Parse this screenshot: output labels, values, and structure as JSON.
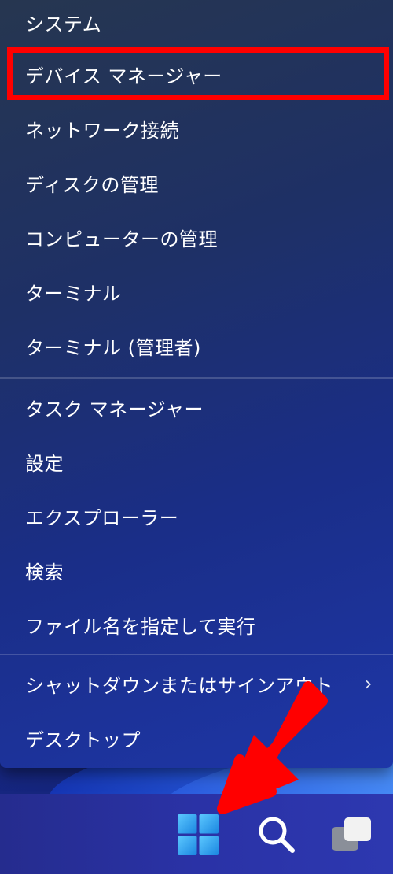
{
  "context_menu": {
    "items": [
      {
        "label": "システム"
      },
      {
        "label": "デバイス マネージャー"
      },
      {
        "label": "ネットワーク接続"
      },
      {
        "label": "ディスクの管理"
      },
      {
        "label": "コンピューターの管理"
      },
      {
        "label": "ターミナル"
      },
      {
        "label": "ターミナル (管理者)"
      },
      {
        "label": "タスク マネージャー"
      },
      {
        "label": "設定"
      },
      {
        "label": "エクスプローラー"
      },
      {
        "label": "検索"
      },
      {
        "label": "ファイル名を指定して実行"
      },
      {
        "label": "シャットダウンまたはサインアウト",
        "submenu_glyph": "›"
      },
      {
        "label": "デスクトップ"
      }
    ],
    "highlighted_item": "デバイス マネージャー"
  },
  "taskbar": {
    "icons": [
      "windows-start-icon",
      "search-icon",
      "task-view-icon"
    ]
  },
  "colors": {
    "highlight": "#ff0000",
    "arrow": "#ff0000",
    "start_icon": "#3aa6f0"
  }
}
